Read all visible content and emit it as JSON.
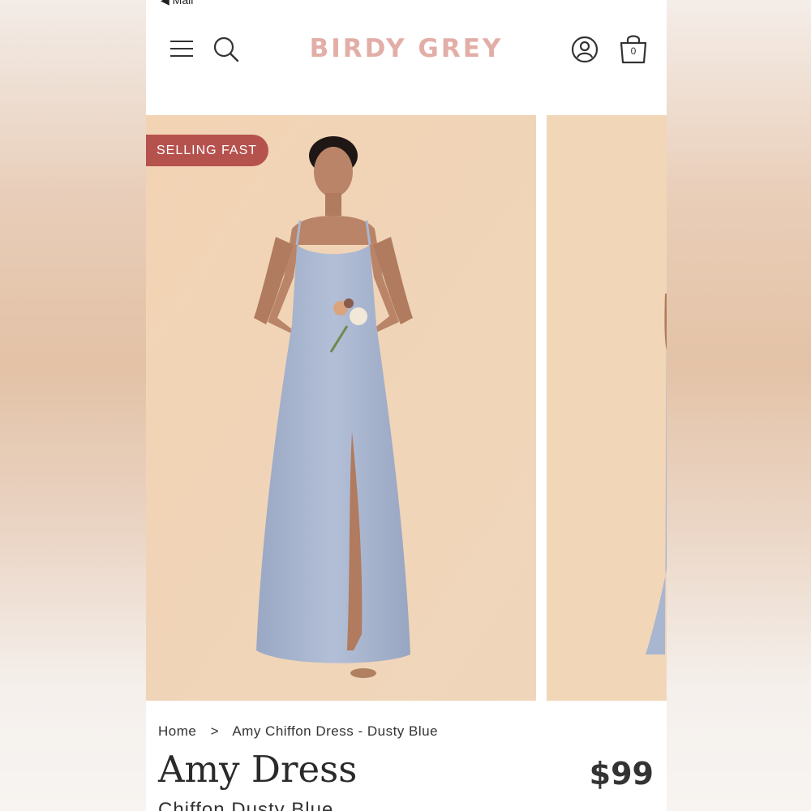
{
  "status": {
    "back_label": "◀ Mail"
  },
  "header": {
    "menu_icon": "hamburger-icon",
    "search_icon": "search-icon",
    "logo": "BIRDY GREY",
    "account_icon": "account-icon",
    "bag_icon": "shopping-bag-icon",
    "bag_count": "0"
  },
  "hero": {
    "badge": "SELLING FAST"
  },
  "breadcrumb": {
    "home": "Home",
    "separator": ">",
    "current": "Amy Chiffon Dress - Dusty Blue"
  },
  "product": {
    "title": "Amy Dress",
    "price": "$99",
    "subtitle": "Chiffon Dusty Blue"
  },
  "colors": {
    "logo": "#e2aea7",
    "badge": "#b6524e",
    "hero_background": "#f0d5b6",
    "dress": "#a9b6d0"
  }
}
